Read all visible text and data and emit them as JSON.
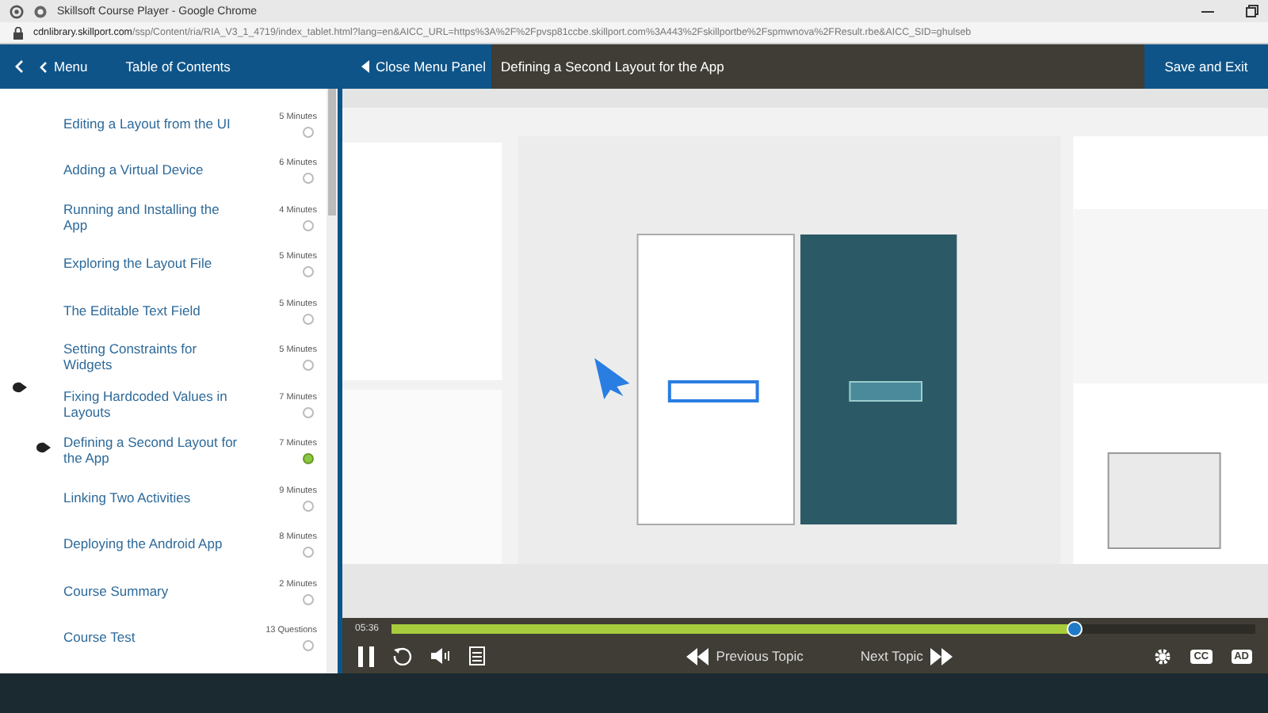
{
  "browser": {
    "title": "Skillsoft Course Player - Google Chrome",
    "url_host": "cdnlibrary.skillport.com",
    "url_path": "/ssp/Content/ria/RIA_V3_1_4719/index_tablet.html?lang=en&AICC_URL=https%3A%2F%2Fpvsp81ccbe.skillport.com%3A443%2Fskillportbe%2Fspmwnova%2FResult.rbe&AICC_SID=ghulseb"
  },
  "header": {
    "menu": "Menu",
    "toc_title": "Table of Contents",
    "close_panel": "Close Menu Panel",
    "topic_title": "Defining a Second Layout for the App",
    "save_exit": "Save and Exit"
  },
  "topics": [
    {
      "title": "Editing a Layout from the UI",
      "duration": "5 Minutes",
      "current": false,
      "marker": false
    },
    {
      "title": "Adding a Virtual Device",
      "duration": "6 Minutes",
      "current": false,
      "marker": false
    },
    {
      "title": "Running and Installing the App",
      "duration": "4 Minutes",
      "current": false,
      "marker": false
    },
    {
      "title": "Exploring the Layout File",
      "duration": "5 Minutes",
      "current": false,
      "marker": false
    },
    {
      "title": "The Editable Text Field",
      "duration": "5 Minutes",
      "current": false,
      "marker": false
    },
    {
      "title": "Setting Constraints for Widgets",
      "duration": "5 Minutes",
      "current": false,
      "marker": false
    },
    {
      "title": "Fixing Hardcoded Values in Layouts",
      "duration": "7 Minutes",
      "current": false,
      "marker": true
    },
    {
      "title": "Defining a Second Layout for the App",
      "duration": "7 Minutes",
      "current": true,
      "marker": true
    },
    {
      "title": "Linking Two Activities",
      "duration": "9 Minutes",
      "current": false,
      "marker": false
    },
    {
      "title": "Deploying the Android App",
      "duration": "8 Minutes",
      "current": false,
      "marker": false
    },
    {
      "title": "Course Summary",
      "duration": "2 Minutes",
      "current": false,
      "marker": false
    },
    {
      "title": "Course Test",
      "duration": "13 Questions",
      "current": false,
      "marker": false
    }
  ],
  "player": {
    "time": "05:36",
    "level": 0.79,
    "previous": "Previous Topic",
    "next": "Next Topic",
    "cc": "CC",
    "ad": "AD"
  }
}
